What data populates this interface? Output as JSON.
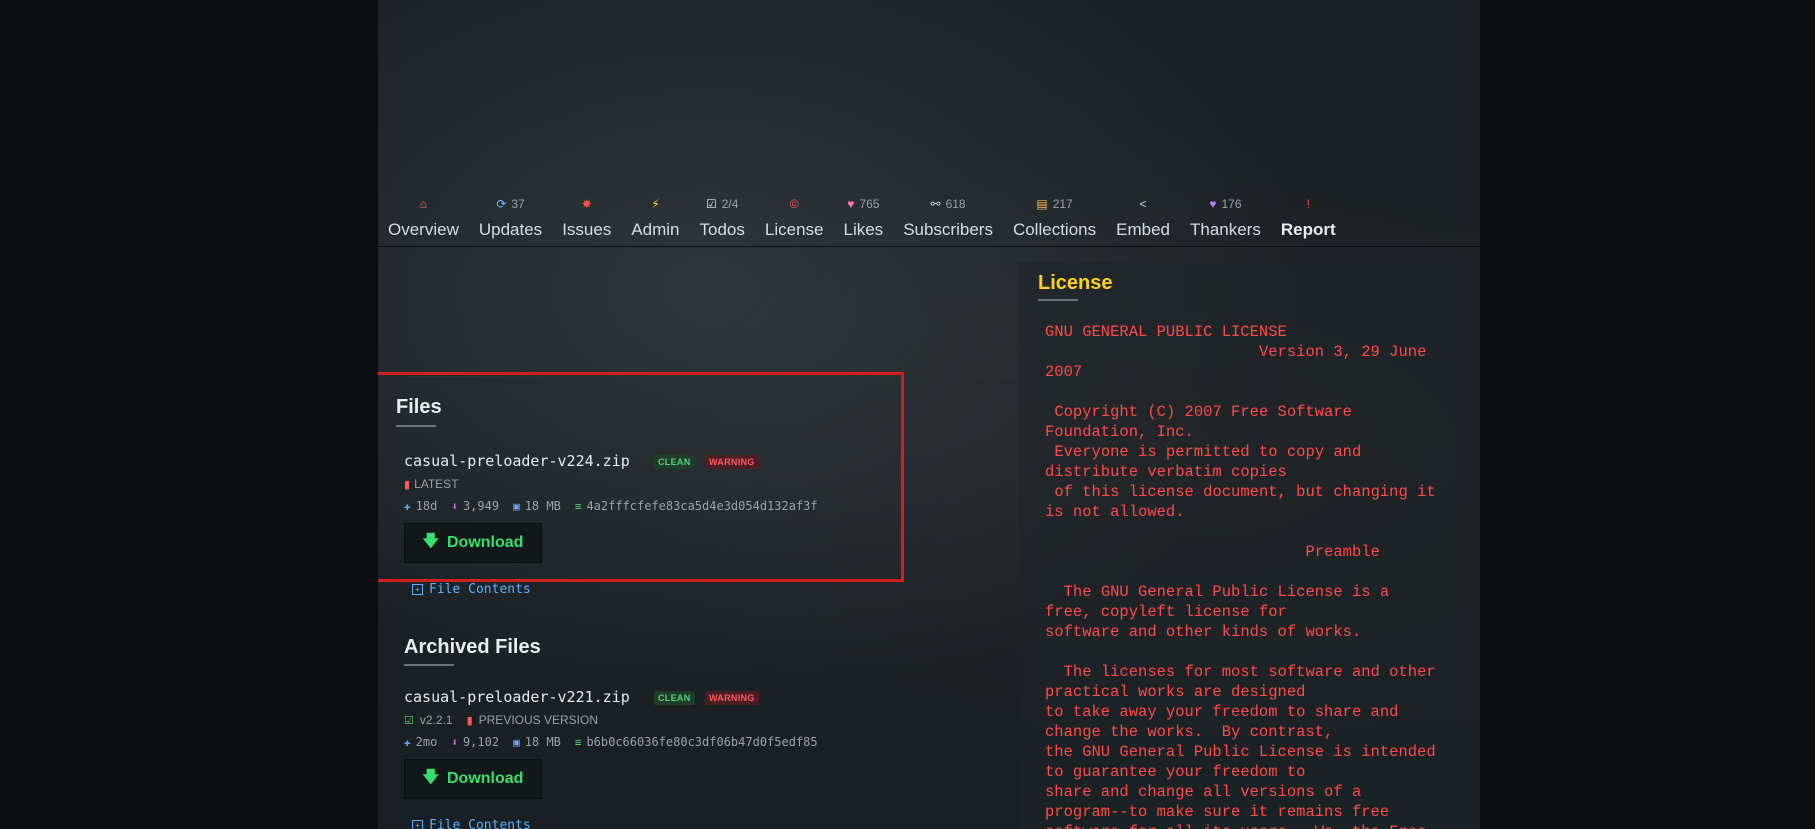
{
  "nav": {
    "items": [
      {
        "icon": "⌂",
        "icon_color": "#ff6b6b",
        "count": "",
        "label": "Overview"
      },
      {
        "icon": "⟳",
        "icon_color": "#7fb8ff",
        "count": "37",
        "label": "Updates"
      },
      {
        "icon": "✸",
        "icon_color": "#ff5050",
        "count": "",
        "label": "Issues"
      },
      {
        "icon": "⚡",
        "icon_color": "#ffd21f",
        "count": "",
        "label": "Admin"
      },
      {
        "icon": "☑",
        "icon_color": "#e6ebee",
        "count": "2/4",
        "label": "Todos"
      },
      {
        "icon": "©",
        "icon_color": "#ff5050",
        "count": "",
        "label": "License"
      },
      {
        "icon": "♥",
        "icon_color": "#ff7aa8",
        "count": "765",
        "label": "Likes"
      },
      {
        "icon": "⚯",
        "icon_color": "#cfd6dc",
        "count": "618",
        "label": "Subscribers"
      },
      {
        "icon": "▤",
        "icon_color": "#ffb84d",
        "count": "217",
        "label": "Collections"
      },
      {
        "icon": "<",
        "icon_color": "#cfd6dc",
        "count": "",
        "label": "Embed"
      },
      {
        "icon": "♥",
        "icon_color": "#c27bff",
        "count": "176",
        "label": "Thankers"
      },
      {
        "icon": "!",
        "icon_color": "#ff4040",
        "count": "",
        "label": "Report"
      }
    ]
  },
  "files": {
    "title": "Files",
    "file": {
      "name": "casual-preloader-v224.zip",
      "tag_clean": "CLEAN",
      "tag_warning": "WARNING",
      "status": "LATEST",
      "age": "18d",
      "downloads": "3,949",
      "size": "18 MB",
      "hash": "4a2fffcfefe83ca5d4e3d054d132af3f",
      "download_label": "Download",
      "contents_label": "File Contents"
    }
  },
  "archived": {
    "title": "Archived Files",
    "file": {
      "name": "casual-preloader-v221.zip",
      "tag_clean": "CLEAN",
      "tag_warning": "WARNING",
      "version": "v2.2.1",
      "status": "PREVIOUS VERSION",
      "age": "2mo",
      "downloads": "9,102",
      "size": "18 MB",
      "hash": "b6b0c66036fe80c3df06b47d0f5edf85",
      "download_label": "Download",
      "contents_label": "File Contents"
    }
  },
  "license": {
    "title": "License",
    "text": "GNU GENERAL PUBLIC LICENSE\n                       Version 3, 29 June\n2007\n\n Copyright (C) 2007 Free Software\nFoundation, Inc.\n Everyone is permitted to copy and\ndistribute verbatim copies\n of this license document, but changing it\nis not allowed.\n\n                            Preamble\n\n  The GNU General Public License is a\nfree, copyleft license for\nsoftware and other kinds of works.\n\n  The licenses for most software and other\npractical works are designed\nto take away your freedom to share and\nchange the works.  By contrast,\nthe GNU General Public License is intended\nto guarantee your freedom to\nshare and change all versions of a\nprogram--to make sure it remains free\nsoftware for all its users.  We, the Free"
  }
}
